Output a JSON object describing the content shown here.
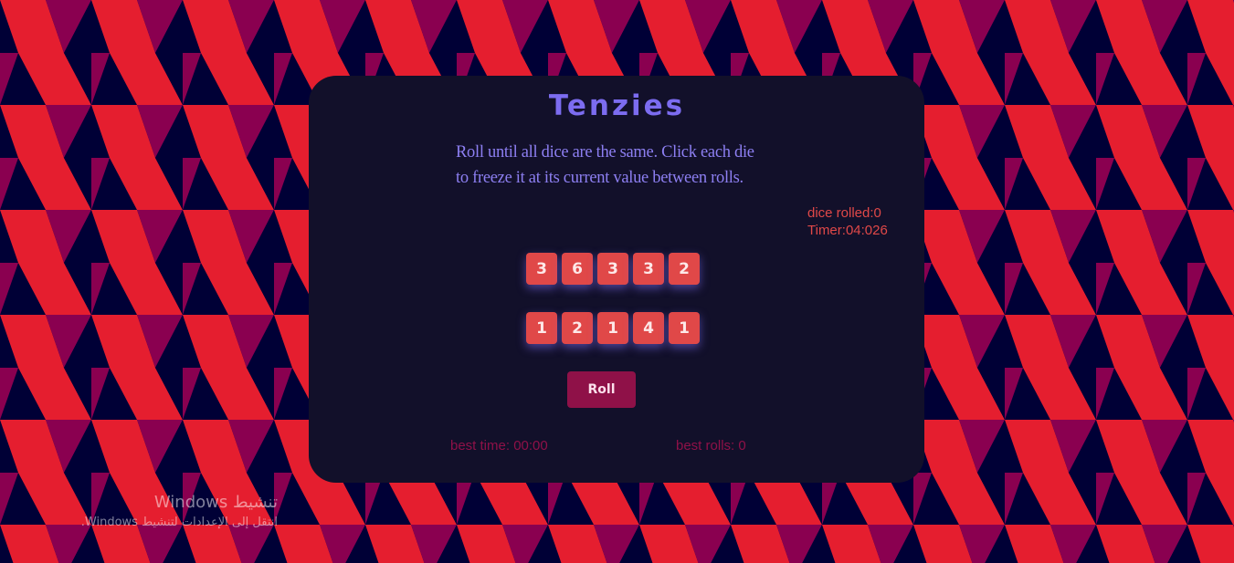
{
  "colors": {
    "background_navy": "#000036",
    "pattern_red": "#e51e2f",
    "pattern_magenta": "#8a0050",
    "card_bg": "#12102a",
    "title": "#7c6cf0",
    "die": "#e04848",
    "roll_button": "#8f1148"
  },
  "app": {
    "title": "Tenzies",
    "instructions": "Roll until all dice are the same. Click each die to freeze it at its current value between rolls."
  },
  "stats": {
    "dice_rolled": "dice rolled:0",
    "timer": "Timer:04:026"
  },
  "dice": {
    "row1": [
      "3",
      "6",
      "3",
      "3",
      "2"
    ],
    "row2": [
      "1",
      "2",
      "1",
      "4",
      "1"
    ]
  },
  "roll_label": "Roll",
  "best": {
    "time": "best time: 00:00",
    "rolls": "best rolls: 0"
  },
  "watermark": {
    "title": "تنشيط Windows",
    "subtitle": "انتقل إلى الإعدادات لتنشيط Windows."
  }
}
